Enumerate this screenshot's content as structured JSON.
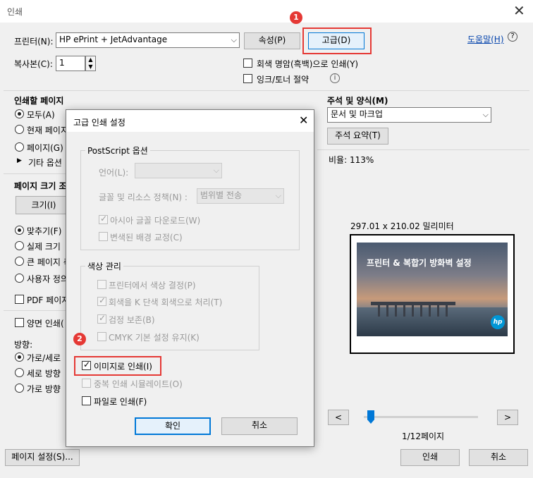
{
  "window": {
    "title": "인쇄"
  },
  "printer": {
    "label": "프린터(N):",
    "selected": "HP ePrint + JetAdvantage",
    "properties_button": "속성(P)",
    "advanced_button": "고급(D)",
    "help_link": "도움말(H)",
    "copies_label": "복사본(C):",
    "copies_value": "1",
    "grayscale_label": "회색 명암(흑백)으로 인쇄(Y)",
    "ink_save_label": "잉크/토너 절약"
  },
  "pages": {
    "title": "인쇄할 페이지",
    "all": "모두(A)",
    "current": "현재 페이지",
    "pages_opt": "페이지(G)",
    "more": "기타 옵션"
  },
  "page_size": {
    "title": "페이지 크기 조",
    "size_button": "크기(I)",
    "fit": "맞추기(F)",
    "actual": "실제 크기",
    "shrink": "큰 페이지 축",
    "custom": "사용자 정의",
    "pdf_paper": "PDF 페이지"
  },
  "duplex": {
    "label": "양면 인쇄("
  },
  "orientation": {
    "title": "방향:",
    "auto": "가로/세로",
    "portrait": "세로 방향",
    "landscape": "가로 방향"
  },
  "comments": {
    "title": "주석 및 양식(M)",
    "selected": "문서 및 마크업",
    "summary_button": "주석 요약(T)"
  },
  "preview": {
    "scale": "비율: 113%",
    "dimensions": "297.01 x 210.02 밀리미터",
    "slide_title": "프린터 & 복합기 방화벽 설정",
    "logo_text": "hp",
    "page_indicator": "1/12페이지",
    "prev": "<",
    "next": ">",
    "slider_value": 0.0
  },
  "footer": {
    "page_setup": "페이지 설정(S)...",
    "print": "인쇄",
    "cancel": "취소"
  },
  "dialog": {
    "title": "고급 인쇄 설정",
    "postscript": {
      "title": "PostScript 옵션",
      "language_label": "언어(L):",
      "font_policy_label": "글꼴 및 리소스 정책(N) :",
      "font_policy_value": "범위별 전송",
      "asian_fonts": "아시아 글꼴 다운로드(W)",
      "bg_correction": "변색된 배경 교정(C)"
    },
    "color": {
      "title": "색상 관리",
      "printer_color": "프린터에서 색상 결정(P)",
      "gray_as_k": "회색을 K 단색 회색으로 처리(T)",
      "preserve_black": "검정 보존(B)",
      "cmyk": "CMYK 기본 설정 유지(K)"
    },
    "print_as_image": "이미지로 인쇄(I)",
    "simulate_overprint": "중복 인쇄 시뮬레이트(O)",
    "print_to_file": "파일로 인쇄(F)",
    "ok": "확인",
    "cancel": "취소"
  },
  "badges": {
    "one": "1",
    "two": "2"
  },
  "colors": {
    "accent": "#0078d7",
    "highlight": "#e53935"
  }
}
